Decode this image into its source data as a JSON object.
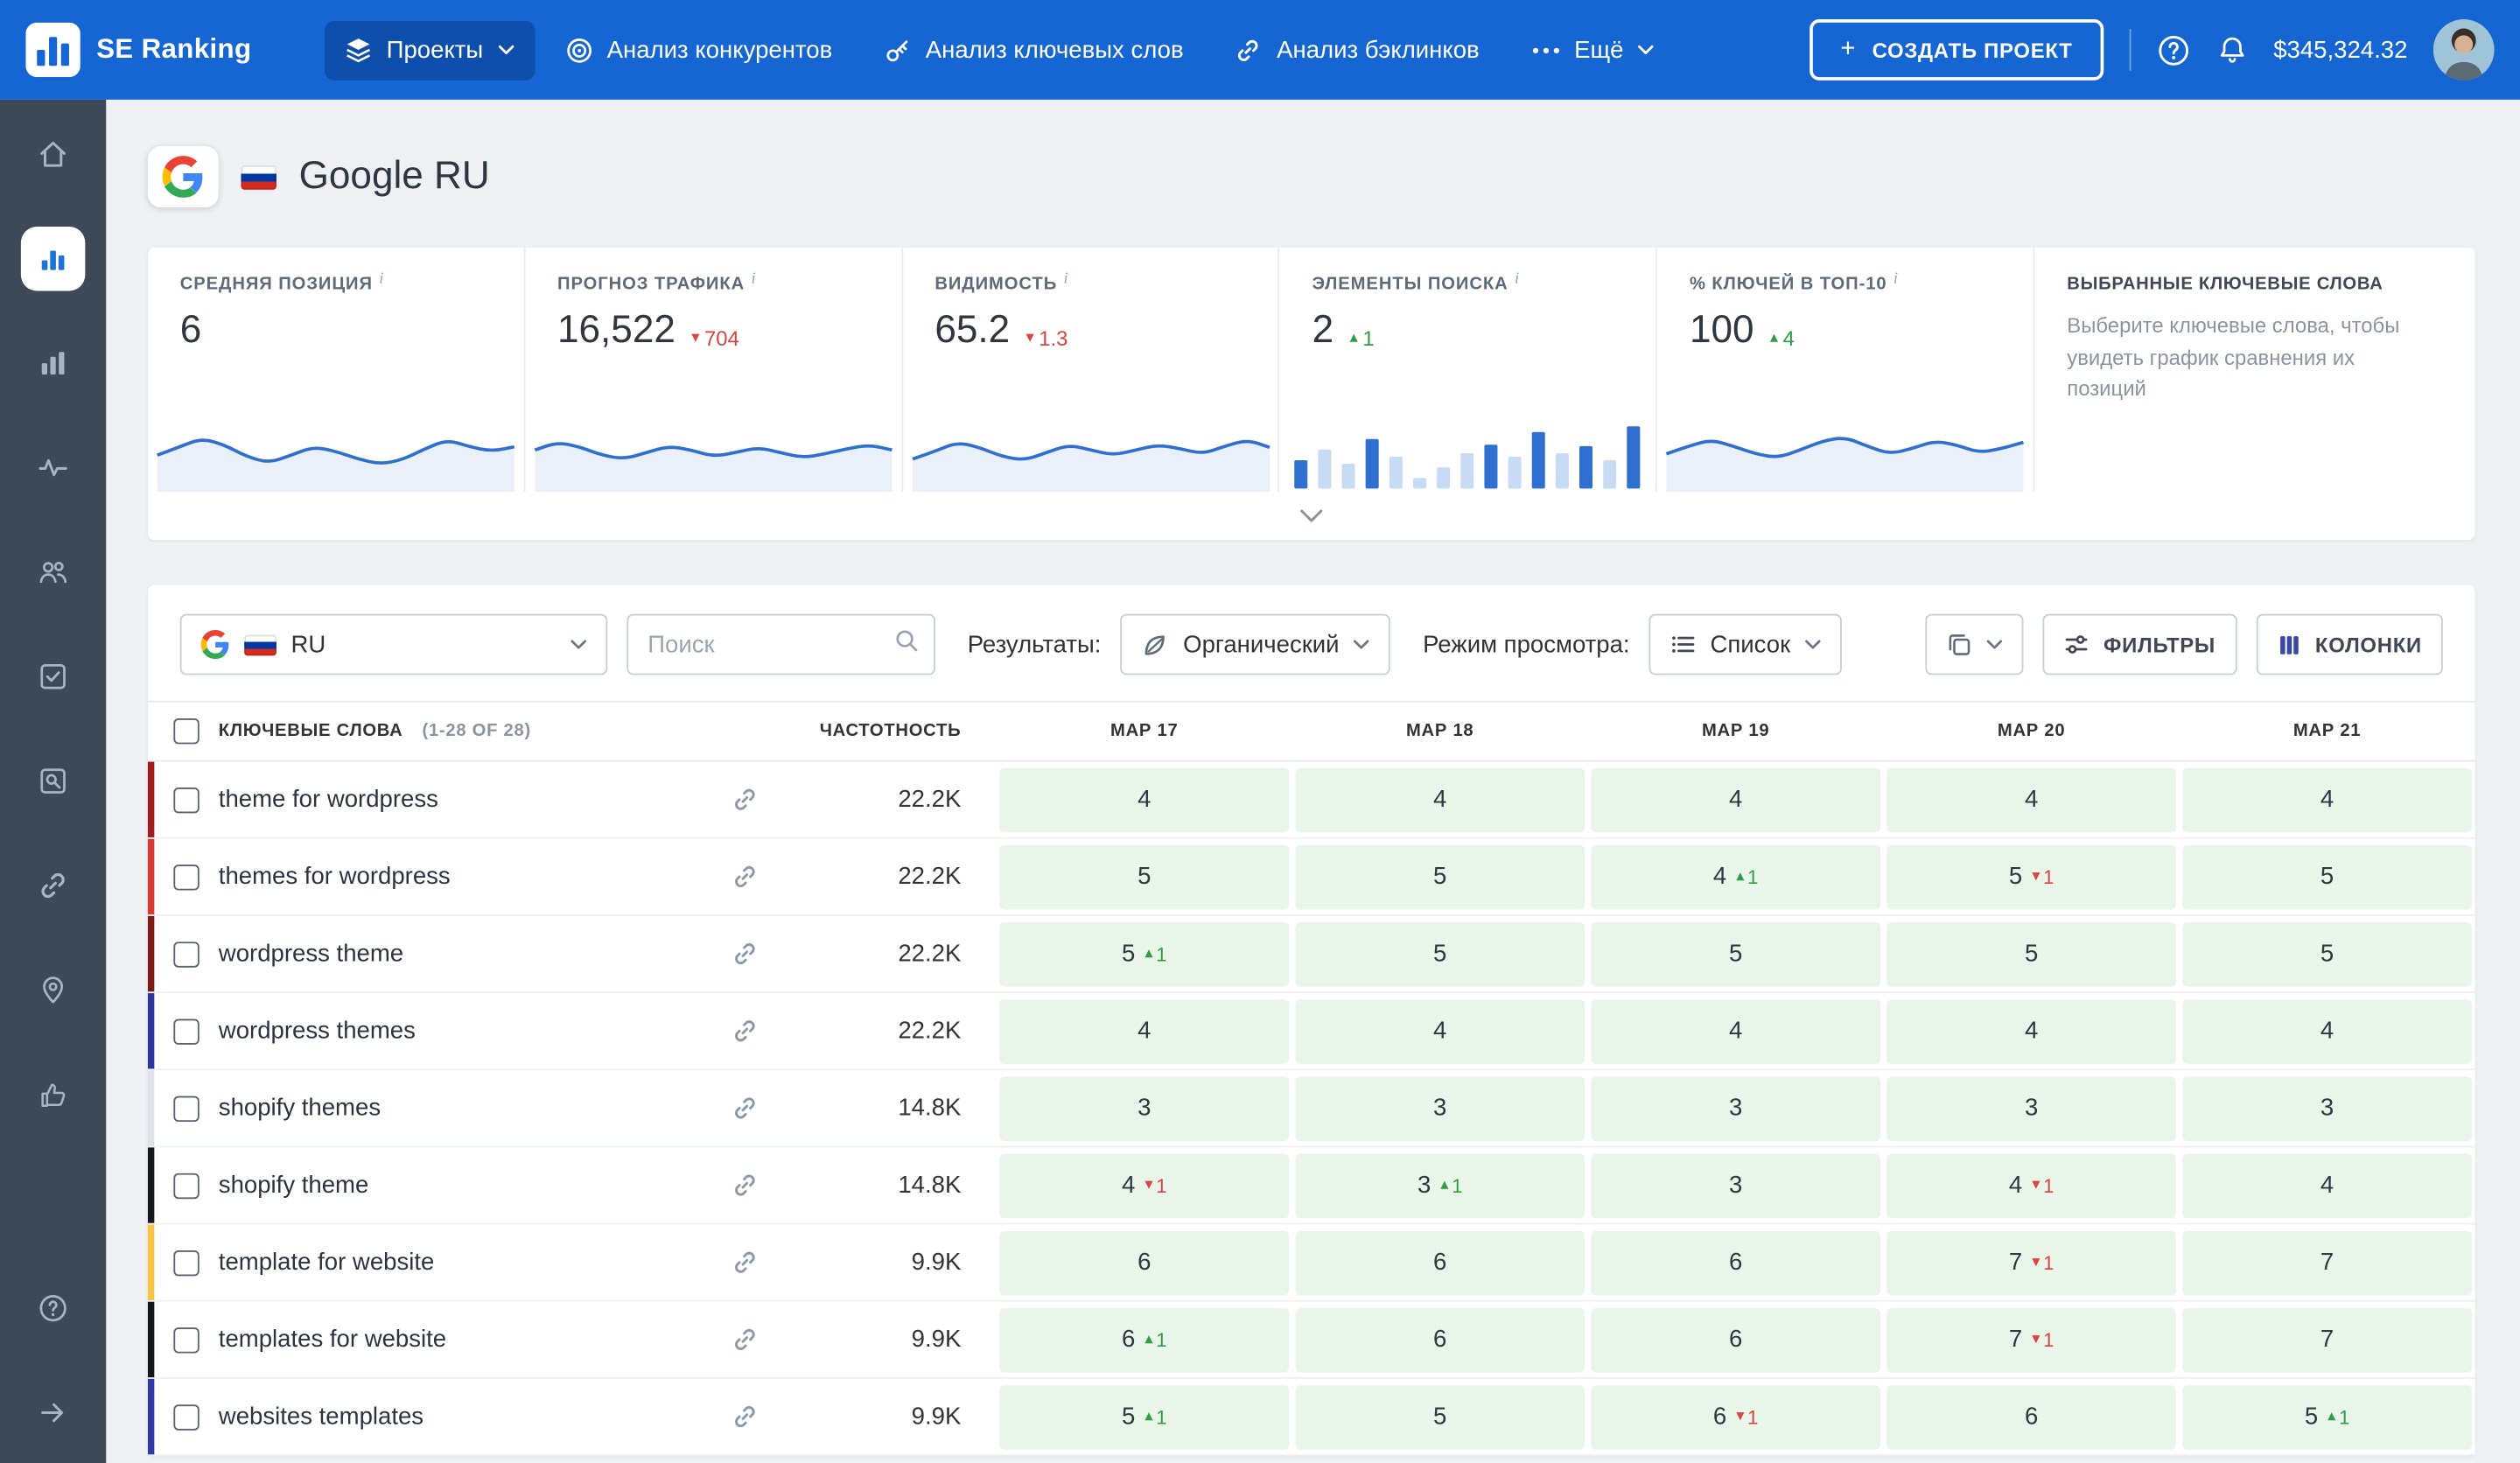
{
  "colors": {
    "topbar": "#1565d2",
    "sidebar": "#3d4859",
    "spark": "#2f6fd0",
    "positive": "#2e9e44",
    "negative": "#d64541",
    "cell_bg": "#e9f5e9"
  },
  "icons": {
    "se-ranking-logo-icon": "bar-chart in white rounded square",
    "layers-icon": "stacked layers",
    "target-icon": "concentric circles",
    "key-icon": "key",
    "link-icon": "chain link",
    "dots-icon": "three dots",
    "plus-icon": "+",
    "help-icon": "? in circle",
    "bell-icon": "bell",
    "chevron-down-icon": "˅",
    "search-icon": "magnifier",
    "organic-icon": "leaf",
    "list-icon": "bulleted list",
    "copy-icon": "two squares",
    "filter-icon": "sliders",
    "columns-icon": "three vertical bars",
    "info-icon": "i"
  },
  "topbar": {
    "brand": "SE Ranking",
    "nav_projects": "Проекты",
    "nav_competitors": "Анализ конкурентов",
    "nav_keywords": "Анализ ключевых слов",
    "nav_backlinks": "Анализ бэклинков",
    "nav_more": "Ещё",
    "create_button": "СОЗДАТЬ ПРОЕКТ",
    "balance": "$345,324.32"
  },
  "page": {
    "title": "Google RU"
  },
  "metrics": {
    "cards": [
      {
        "label": "СРЕДНЯЯ ПОЗИЦИЯ",
        "value": "6",
        "spark": [
          0.42,
          0.55,
          0.68,
          0.58,
          0.4,
          0.3,
          0.42,
          0.55,
          0.48,
          0.36,
          0.28,
          0.35,
          0.52,
          0.66,
          0.55,
          0.48,
          0.55
        ]
      },
      {
        "label": "ПРОГНОЗ ТРАФИКА",
        "value": "16,522",
        "delta": "704",
        "dir": "down",
        "spark": [
          0.5,
          0.62,
          0.55,
          0.42,
          0.36,
          0.46,
          0.56,
          0.5,
          0.4,
          0.46,
          0.54,
          0.46,
          0.38,
          0.44,
          0.52,
          0.58,
          0.5
        ]
      },
      {
        "label": "ВИДИМОСТЬ",
        "value": "65.2",
        "delta": "1.3",
        "dir": "down",
        "spark": [
          0.36,
          0.48,
          0.62,
          0.54,
          0.4,
          0.34,
          0.46,
          0.58,
          0.5,
          0.42,
          0.5,
          0.58,
          0.52,
          0.44,
          0.56,
          0.66,
          0.54
        ]
      },
      {
        "label": "ЭЛЕМЕНТЫ ПОИСКА",
        "value": "2",
        "delta": "1",
        "dir": "up",
        "bars": [
          {
            "h": 0.4,
            "strong": true
          },
          {
            "h": 0.55,
            "strong": false
          },
          {
            "h": 0.35,
            "strong": false
          },
          {
            "h": 0.7,
            "strong": true
          },
          {
            "h": 0.45,
            "strong": false
          },
          {
            "h": 0.15,
            "strong": false
          },
          {
            "h": 0.3,
            "strong": false
          },
          {
            "h": 0.5,
            "strong": false
          },
          {
            "h": 0.62,
            "strong": true
          },
          {
            "h": 0.45,
            "strong": false
          },
          {
            "h": 0.8,
            "strong": true
          },
          {
            "h": 0.5,
            "strong": false
          },
          {
            "h": 0.6,
            "strong": true
          },
          {
            "h": 0.4,
            "strong": false
          },
          {
            "h": 0.88,
            "strong": true
          }
        ]
      },
      {
        "label": "% КЛЮЧЕЙ В ТОП-10",
        "value": "100",
        "delta": "4",
        "dir": "up",
        "spark": [
          0.44,
          0.56,
          0.66,
          0.56,
          0.44,
          0.38,
          0.5,
          0.64,
          0.7,
          0.56,
          0.44,
          0.52,
          0.64,
          0.58,
          0.46,
          0.52,
          0.62
        ]
      }
    ],
    "selected": {
      "title": "ВЫБРАННЫЕ КЛЮЧЕВЫЕ СЛОВА",
      "text": "Выберите ключевые слова, чтобы увидеть график сравнения их позиций"
    }
  },
  "toolbar": {
    "language": "RU",
    "search_placeholder": "Поиск",
    "results_label": "Результаты:",
    "results_value": "Органический",
    "view_label": "Режим просмотра:",
    "view_value": "Список",
    "filters": "ФИЛЬТРЫ",
    "columns": "КОЛОНКИ"
  },
  "table": {
    "keywords_header": "КЛЮЧЕВЫЕ СЛОВА",
    "keywords_count": "(1-28 OF 28)",
    "volume_header": "ЧАСТОТНОСТЬ",
    "date_headers": [
      "МАР 17",
      "МАР 18",
      "МАР 19",
      "МАР 20",
      "МАР 21"
    ],
    "rows": [
      {
        "keyword": "theme for wordpress",
        "volume": "22.2K",
        "stripe": "#a01b1b",
        "cells": [
          {
            "value": "4"
          },
          {
            "value": "4"
          },
          {
            "value": "4"
          },
          {
            "value": "4"
          },
          {
            "value": "4"
          }
        ]
      },
      {
        "keyword": "themes for wordpress",
        "volume": "22.2K",
        "stripe": "#d93a35",
        "cells": [
          {
            "value": "5"
          },
          {
            "value": "5"
          },
          {
            "value": "4",
            "delta": "1",
            "dir": "up"
          },
          {
            "value": "5",
            "delta": "1",
            "dir": "down"
          },
          {
            "value": "5"
          }
        ]
      },
      {
        "keyword": "wordpress theme",
        "volume": "22.2K",
        "stripe": "#7c1a16",
        "cells": [
          {
            "value": "5",
            "delta": "1",
            "dir": "up"
          },
          {
            "value": "5"
          },
          {
            "value": "5"
          },
          {
            "value": "5"
          },
          {
            "value": "5"
          }
        ]
      },
      {
        "keyword": "wordpress themes",
        "volume": "22.2K",
        "stripe": "#27359c",
        "cells": [
          {
            "value": "4"
          },
          {
            "value": "4"
          },
          {
            "value": "4"
          },
          {
            "value": "4"
          },
          {
            "value": "4"
          }
        ]
      },
      {
        "keyword": "shopify themes",
        "volume": "14.8K",
        "stripe": "#dfe3e8",
        "cells": [
          {
            "value": "3"
          },
          {
            "value": "3"
          },
          {
            "value": "3"
          },
          {
            "value": "3"
          },
          {
            "value": "3"
          }
        ]
      },
      {
        "keyword": "shopify theme",
        "volume": "14.8K",
        "stripe": "#16181b",
        "cells": [
          {
            "value": "4",
            "delta": "1",
            "dir": "down"
          },
          {
            "value": "3",
            "delta": "1",
            "dir": "up"
          },
          {
            "value": "3"
          },
          {
            "value": "4",
            "delta": "1",
            "dir": "down"
          },
          {
            "value": "4"
          }
        ]
      },
      {
        "keyword": "template for website",
        "volume": "9.9K",
        "stripe": "#f6c344",
        "cells": [
          {
            "value": "6"
          },
          {
            "value": "6"
          },
          {
            "value": "6"
          },
          {
            "value": "7",
            "delta": "1",
            "dir": "down"
          },
          {
            "value": "7"
          }
        ]
      },
      {
        "keyword": "templates for website",
        "volume": "9.9K",
        "stripe": "#141619",
        "cells": [
          {
            "value": "6",
            "delta": "1",
            "dir": "up"
          },
          {
            "value": "6"
          },
          {
            "value": "6"
          },
          {
            "value": "7",
            "delta": "1",
            "dir": "down"
          },
          {
            "value": "7"
          }
        ]
      },
      {
        "keyword": "websites templates",
        "volume": "9.9K",
        "stripe": "#2d3aa3",
        "cells": [
          {
            "value": "5",
            "delta": "1",
            "dir": "up"
          },
          {
            "value": "5"
          },
          {
            "value": "6",
            "delta": "1",
            "dir": "down"
          },
          {
            "value": "6"
          },
          {
            "value": "5",
            "delta": "1",
            "dir": "up"
          }
        ]
      }
    ]
  }
}
